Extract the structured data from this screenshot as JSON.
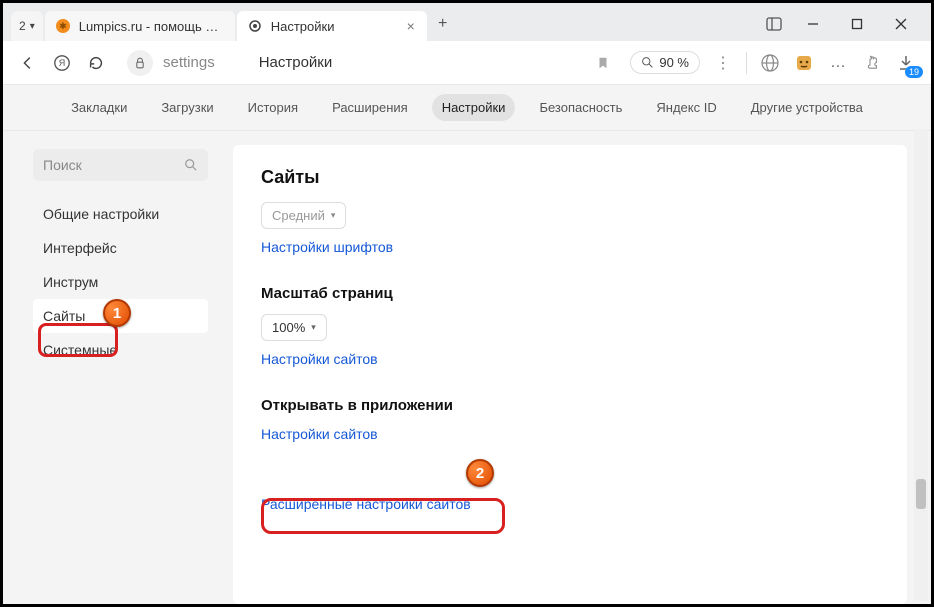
{
  "tabs": {
    "group_count": "2",
    "tab1": {
      "title": "Lumpics.ru - помощь с ком"
    },
    "tab2": {
      "title": "Настройки"
    }
  },
  "window": {
    "min": "—",
    "max": "□",
    "close": "×"
  },
  "addr": {
    "url": "settings",
    "page_title": "Настройки",
    "zoom": "90 %",
    "download_badge": "19"
  },
  "topnav": {
    "items": [
      "Закладки",
      "Загрузки",
      "История",
      "Расширения",
      "Настройки",
      "Безопасность",
      "Яндекс ID",
      "Другие устройства"
    ],
    "active_index": 4
  },
  "sidebar": {
    "search_placeholder": "Поиск",
    "items": [
      "Общие настройки",
      "Интерфейс",
      "Инструм",
      "Сайты",
      "Системные"
    ],
    "active_index": 3
  },
  "main": {
    "heading": "Сайты",
    "font_select": "Средний",
    "font_link": "Настройки шрифтов",
    "scale_heading": "Масштаб страниц",
    "scale_select": "100%",
    "scale_link": "Настройки сайтов",
    "open_heading": "Открывать в приложении",
    "open_link": "Настройки сайтов",
    "advanced_link": "Расширенные настройки сайтов"
  },
  "markers": {
    "m1": "1",
    "m2": "2"
  }
}
